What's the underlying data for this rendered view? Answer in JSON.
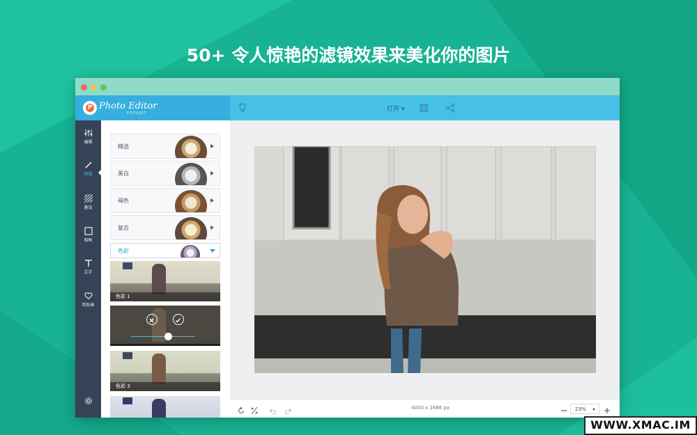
{
  "headline": "50+ 令人惊艳的滤镜效果来美化你的图片",
  "app": {
    "logo_title": "Photo Editor",
    "logo_subtitle": "POTOJET",
    "logo_letter": "P"
  },
  "toolbar": {
    "open_label": "打开 ▾",
    "icons": [
      "lightbulb-icon",
      "save-icon",
      "share-icon"
    ]
  },
  "sidebar": {
    "items": [
      {
        "label": "编辑",
        "icon": "sliders-icon"
      },
      {
        "label": "特效",
        "icon": "magic-wand-icon",
        "active": true
      },
      {
        "label": "叠加",
        "icon": "stripes-icon"
      },
      {
        "label": "相框",
        "icon": "frame-icon"
      },
      {
        "label": "文字",
        "icon": "text-icon"
      },
      {
        "label": "剪贴画",
        "icon": "heart-icon"
      }
    ],
    "bottom_icon": "gear-icon"
  },
  "filters": {
    "categories": [
      {
        "label": "精选"
      },
      {
        "label": "黑白"
      },
      {
        "label": "褐色"
      },
      {
        "label": "复古"
      }
    ],
    "selected_category": "色彩",
    "presets": [
      {
        "label": "色彩 1"
      },
      {
        "label": ""
      },
      {
        "label": "色彩 3"
      }
    ],
    "slider_value": 0.58,
    "slider_icons": [
      "close-icon",
      "check-icon"
    ]
  },
  "status": {
    "dimensions": "4000 x 2666 px",
    "zoom": "23%",
    "icons": [
      "rotate-icon",
      "compare-icon",
      "undo-icon",
      "redo-icon",
      "zoom-out-icon",
      "zoom-in-icon"
    ]
  },
  "watermark": "WWW.XMAC.IM",
  "colors": {
    "background": "#17b393",
    "toolbar": "#46c0e6",
    "sidebar": "#354357",
    "accent": "#2a9fd0"
  }
}
